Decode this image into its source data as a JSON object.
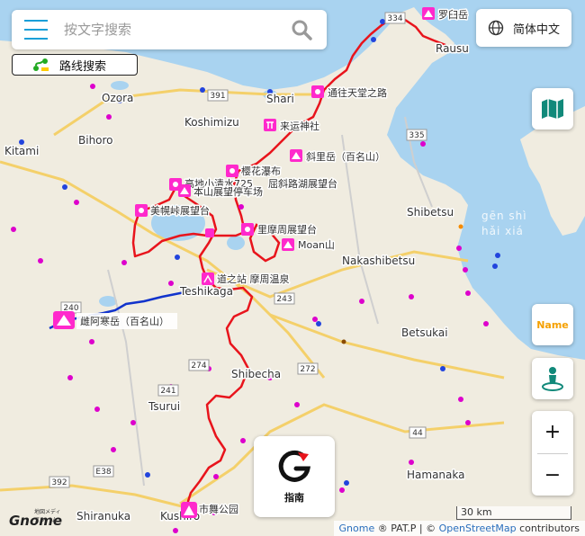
{
  "search": {
    "placeholder": "按文字搜索"
  },
  "route_button": {
    "label": "路线搜索"
  },
  "language_button": {
    "label": "简体中文"
  },
  "name_button": {
    "label": "Name"
  },
  "zoom": {
    "in_label": "+",
    "out_label": "−"
  },
  "compass": {
    "label": "指南"
  },
  "scale": {
    "label": "30 km"
  },
  "attribution": {
    "gnome": "Gnome",
    "patp": " ® PAT.P | © ",
    "osm": "OpenStreetMap",
    "contrib": " contributors"
  },
  "logo": {
    "text": "Gnome",
    "subtitle": "地図メディア ノーム"
  },
  "places": {
    "kitami": "Kitami",
    "bihoro": "Bihoro",
    "ozora": "Ozora",
    "koshimizu": "Koshimizu",
    "shari": "Shari",
    "rausu": "Rausu",
    "shibetsu": "Shibetsu",
    "nakashibetsu": "Nakashibetsu",
    "teshikaga": "Teshikaga",
    "betsukai": "Betsukai",
    "shibecha": "Shibecha",
    "tsurui": "Tsurui",
    "hamanaka": "Hamanaka",
    "kushiro": "Kushiro",
    "shiranuka": "Shiranuka"
  },
  "water": {
    "line1": "gēn shì",
    "line2": "hǎi xiá"
  },
  "roads": {
    "r391": "391",
    "r334": "334",
    "r335": "335",
    "r243": "243",
    "r272": "272",
    "r274": "274",
    "r240": "240",
    "r241": "241",
    "r44": "44",
    "r38": "E38",
    "r392": "392"
  },
  "pois": {
    "rausu_dake": "罗臼岳",
    "tentou": "通往天堂之路",
    "raiun": "来运神社",
    "sharidake": "斜里岳（百名山）",
    "sakura_falls": "樱花瀑布",
    "kotsu_pass": "屈斜路湖展望台",
    "bihoro_pass_a": "高地小清水725",
    "bihoro_pass_b": "本山展望停车场",
    "bihoro_tenbo": "美幌峠展望台",
    "moan": "Moan山",
    "tama_tenbo": "里摩周展望台",
    "masyu_onsen": "道之站 摩周温泉",
    "meakan": "雌阿寒岳（百名山）",
    "kushiro_park": "市舞公园"
  }
}
